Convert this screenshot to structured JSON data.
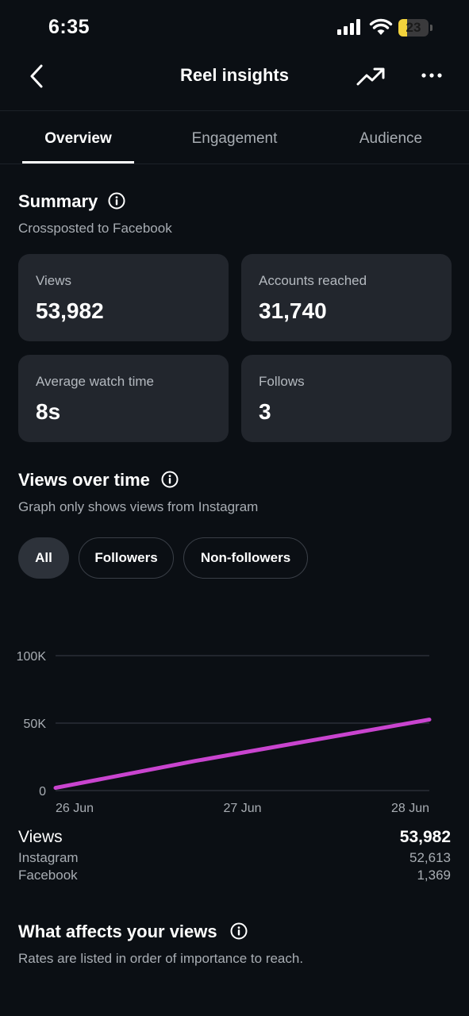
{
  "status": {
    "time": "6:35",
    "battery": "23"
  },
  "nav": {
    "title": "Reel insights"
  },
  "tabs": [
    {
      "label": "Overview",
      "active": true
    },
    {
      "label": "Engagement",
      "active": false
    },
    {
      "label": "Audience",
      "active": false
    }
  ],
  "summary": {
    "title": "Summary",
    "subtitle": "Crossposted to Facebook",
    "cards": [
      {
        "label": "Views",
        "value": "53,982"
      },
      {
        "label": "Accounts reached",
        "value": "31,740"
      },
      {
        "label": "Average watch time",
        "value": "8s"
      },
      {
        "label": "Follows",
        "value": "3"
      }
    ]
  },
  "views_over_time": {
    "title": "Views over time",
    "subtitle": "Graph only shows views from Instagram",
    "filters": [
      "All",
      "Followers",
      "Non-followers"
    ],
    "active_filter": "All"
  },
  "chart_data": {
    "type": "line",
    "x": [
      "26 Jun",
      "26.75 Jun",
      "28 Jun"
    ],
    "x_tick_labels": [
      "26 Jun",
      "27 Jun",
      "28 Jun"
    ],
    "y_tick_labels": [
      "100K",
      "50K",
      "0"
    ],
    "ylim": [
      0,
      100000
    ],
    "series": [
      {
        "values": [
          2000,
          22000,
          52613
        ],
        "color": "#c944cf"
      }
    ],
    "grid": true
  },
  "views_breakdown": {
    "label": "Views",
    "total": "53,982",
    "rows": [
      {
        "label": "Instagram",
        "value": "52,613"
      },
      {
        "label": "Facebook",
        "value": "1,369"
      }
    ]
  },
  "affects": {
    "title": "What affects your views",
    "subtitle": "Rates are listed in order of importance to reach."
  },
  "colors": {
    "background": "#0b0f14",
    "card": "#22262d",
    "accent_line": "#c944cf"
  }
}
